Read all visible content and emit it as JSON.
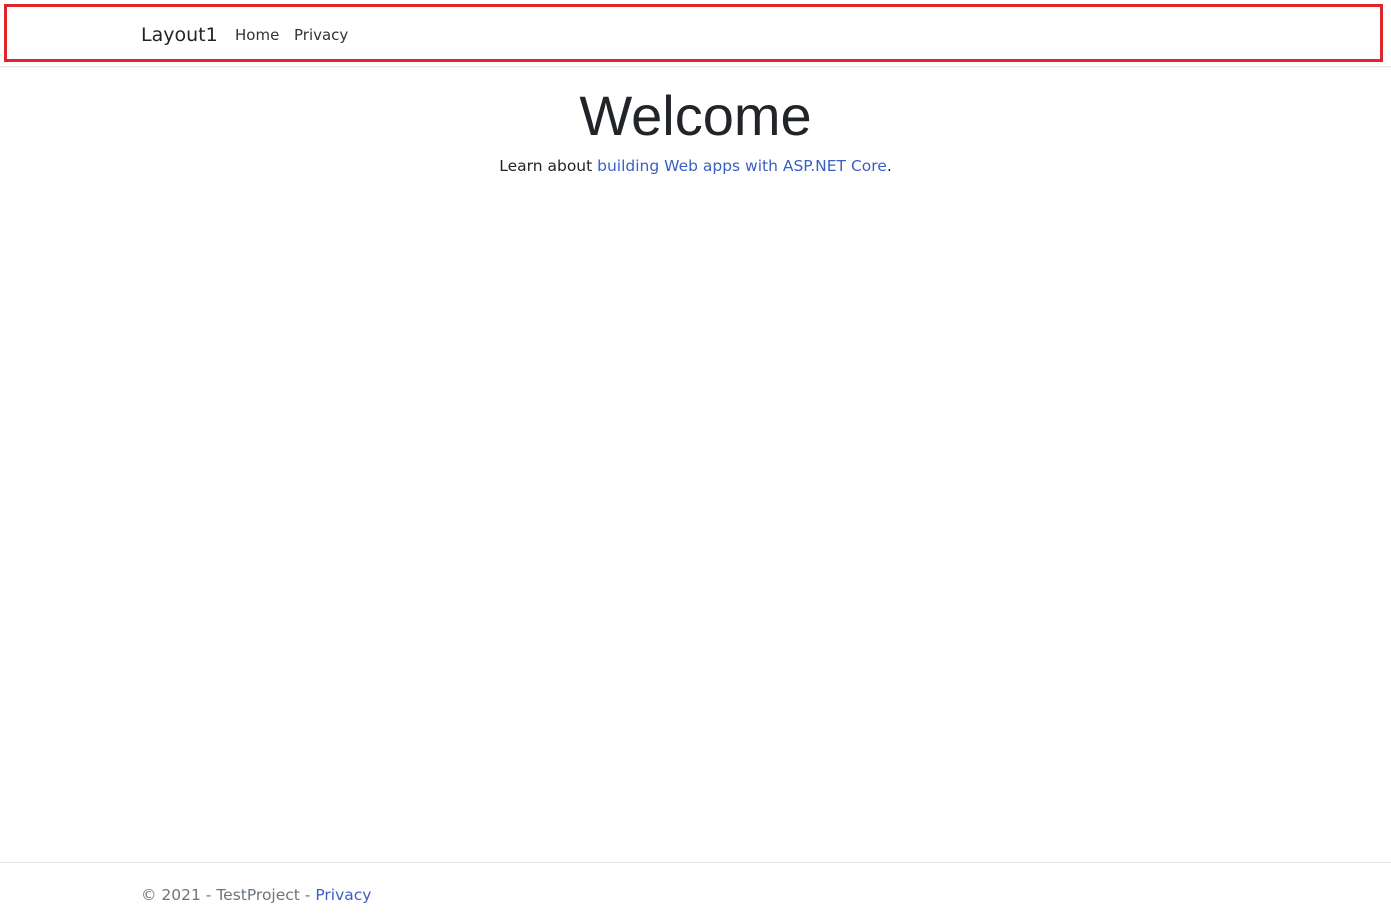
{
  "navbar": {
    "brand": "Layout1",
    "links": [
      {
        "label": "Home"
      },
      {
        "label": "Privacy"
      }
    ],
    "highlight_color": "#e0242b"
  },
  "main": {
    "title": "Welcome",
    "lead_prefix": "Learn about ",
    "lead_link": "building Web apps with ASP.NET Core",
    "lead_suffix": "."
  },
  "footer": {
    "copyright": "© 2021 - TestProject - ",
    "privacy_link": "Privacy"
  },
  "colors": {
    "link": "#3b5fc4",
    "text": "#212529",
    "muted": "#6c757d"
  }
}
